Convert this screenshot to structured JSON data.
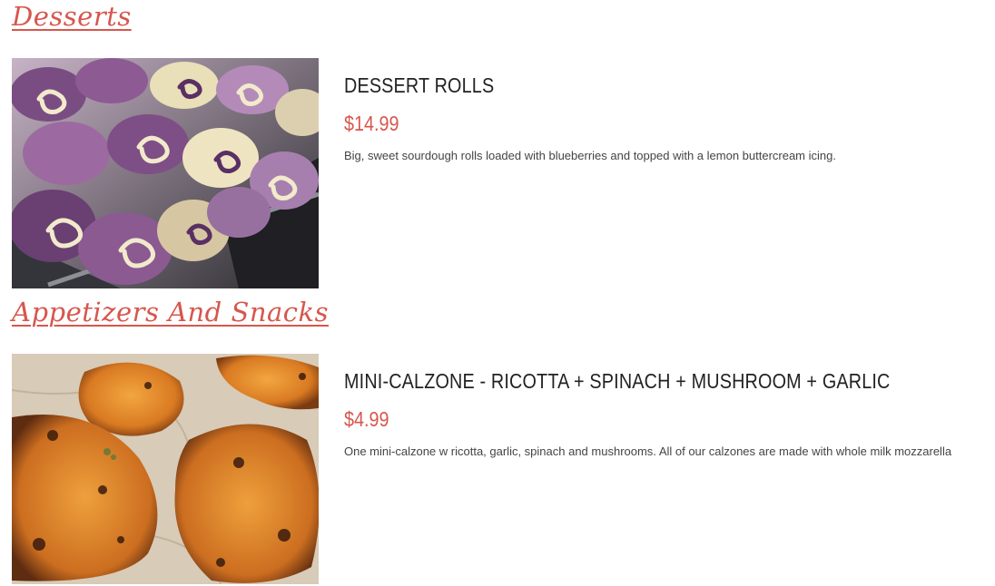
{
  "sections": [
    {
      "title": "Desserts",
      "items": [
        {
          "name": "DESSERT ROLLS",
          "price": "$14.99",
          "description": "Big, sweet sourdough rolls loaded with blueberries and topped with a lemon buttercream icing.",
          "image": "blueberry-rolls-photo"
        }
      ]
    },
    {
      "title": "Appetizers And Snacks",
      "items": [
        {
          "name": "MINI-CALZONE - RICOTTA + SPINACH + MUSHROOM + GARLIC",
          "price": "$4.99",
          "description": "One mini-calzone w ricotta, garlic, spinach and mushrooms. All of our calzones are made with whole milk mozzarella",
          "image": "calzones-photo"
        }
      ]
    }
  ],
  "colors": {
    "accent": "#d7564d",
    "heading_text": "#222222",
    "body_text": "#444444"
  }
}
